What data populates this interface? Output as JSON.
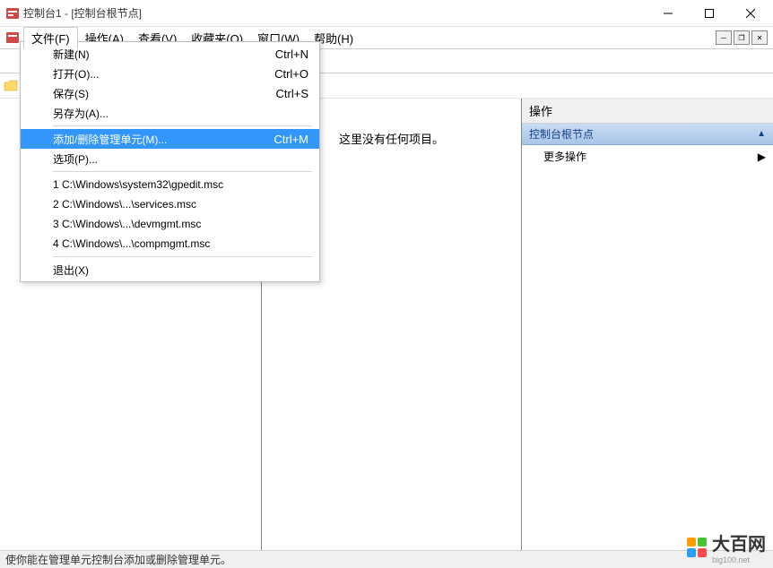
{
  "title": "控制台1 - [控制台根节点]",
  "menu": {
    "file": "文件(F)",
    "action": "操作(A)",
    "view": "查看(V)",
    "favorites": "收藏夹(O)",
    "window": "窗口(W)",
    "help": "帮助(H)"
  },
  "dropdown": {
    "new": {
      "label": "新建(N)",
      "shortcut": "Ctrl+N"
    },
    "open": {
      "label": "打开(O)...",
      "shortcut": "Ctrl+O"
    },
    "save": {
      "label": "保存(S)",
      "shortcut": "Ctrl+S"
    },
    "saveas": {
      "label": "另存为(A)..."
    },
    "addremove": {
      "label": "添加/删除管理单元(M)...",
      "shortcut": "Ctrl+M"
    },
    "options": {
      "label": "选项(P)..."
    },
    "recent1": "1 C:\\Windows\\system32\\gpedit.msc",
    "recent2": "2 C:\\Windows\\...\\services.msc",
    "recent3": "3 C:\\Windows\\...\\devmgmt.msc",
    "recent4": "4 C:\\Windows\\...\\compmgmt.msc",
    "exit": "退出(X)"
  },
  "main": {
    "empty": "这里没有任何项目。"
  },
  "actions": {
    "header": "操作",
    "section": "控制台根节点",
    "more": "更多操作"
  },
  "statusbar": "使你能在管理单元控制台添加或删除管理单元。",
  "watermark": {
    "text": "大百网",
    "sub": "big100.net"
  },
  "colors": {
    "highlight": "#3296fa",
    "action_grad_top": "#c9dcf2",
    "action_grad_bot": "#a9c6e8"
  }
}
